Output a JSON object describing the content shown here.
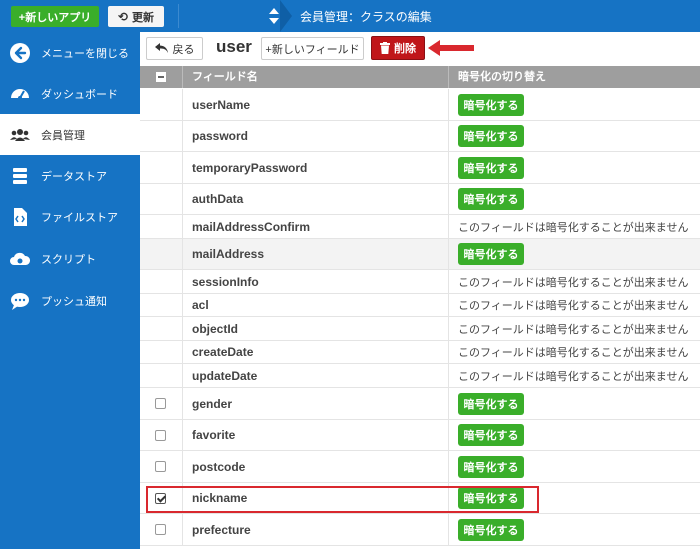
{
  "topbar": {
    "new_app_label": "+新しいアプリ",
    "refresh_label": "更新",
    "class_select_label": "会員管理：クラスの編集"
  },
  "sidebar": {
    "items": [
      {
        "label": "メニューを閉じる",
        "icon": "arrow-left-circle-icon"
      },
      {
        "label": "ダッシュボード",
        "icon": "speedometer-icon"
      },
      {
        "label": "会員管理",
        "icon": "users-icon",
        "active": true
      },
      {
        "label": "データストア",
        "icon": "database-icon"
      },
      {
        "label": "ファイルストア",
        "icon": "file-code-icon"
      },
      {
        "label": "スクリプト",
        "icon": "cloud-gear-icon"
      },
      {
        "label": "プッシュ通知",
        "icon": "chat-bubble-icon"
      }
    ]
  },
  "toolbar": {
    "back_label": "戻る",
    "class_name": "user",
    "new_field_label": "+新しいフィールド",
    "delete_label": "削除"
  },
  "table": {
    "headers": {
      "field": "フィールド名",
      "encryption": "暗号化の切り替え"
    },
    "encrypt_label": "暗号化する",
    "not_encryptable_label": "このフィールドは暗号化することが出来ません",
    "rows": [
      {
        "field": "userName",
        "encryptable": true,
        "checkbox": false
      },
      {
        "field": "password",
        "encryptable": true,
        "checkbox": false
      },
      {
        "field": "temporaryPassword",
        "encryptable": true,
        "checkbox": false
      },
      {
        "field": "authData",
        "encryptable": true,
        "checkbox": false
      },
      {
        "field": "mailAddressConfirm",
        "encryptable": false,
        "checkbox": false
      },
      {
        "field": "mailAddress",
        "encryptable": true,
        "checkbox": false
      },
      {
        "field": "sessionInfo",
        "encryptable": false,
        "checkbox": false
      },
      {
        "field": "acl",
        "encryptable": false,
        "checkbox": false
      },
      {
        "field": "objectId",
        "encryptable": false,
        "checkbox": false
      },
      {
        "field": "createDate",
        "encryptable": false,
        "checkbox": false
      },
      {
        "field": "updateDate",
        "encryptable": false,
        "checkbox": false
      },
      {
        "field": "gender",
        "encryptable": true,
        "checkbox": true,
        "checked": false
      },
      {
        "field": "favorite",
        "encryptable": true,
        "checkbox": true,
        "checked": false
      },
      {
        "field": "postcode",
        "encryptable": true,
        "checkbox": true,
        "checked": false
      },
      {
        "field": "nickname",
        "encryptable": true,
        "checkbox": true,
        "checked": true
      },
      {
        "field": "prefecture",
        "encryptable": true,
        "checkbox": true,
        "checked": false
      }
    ]
  },
  "colors": {
    "primary_blue": "#1673c4",
    "green_button": "#3aae2a",
    "delete_red": "#c0161a",
    "annotation_red": "#d9282e"
  }
}
